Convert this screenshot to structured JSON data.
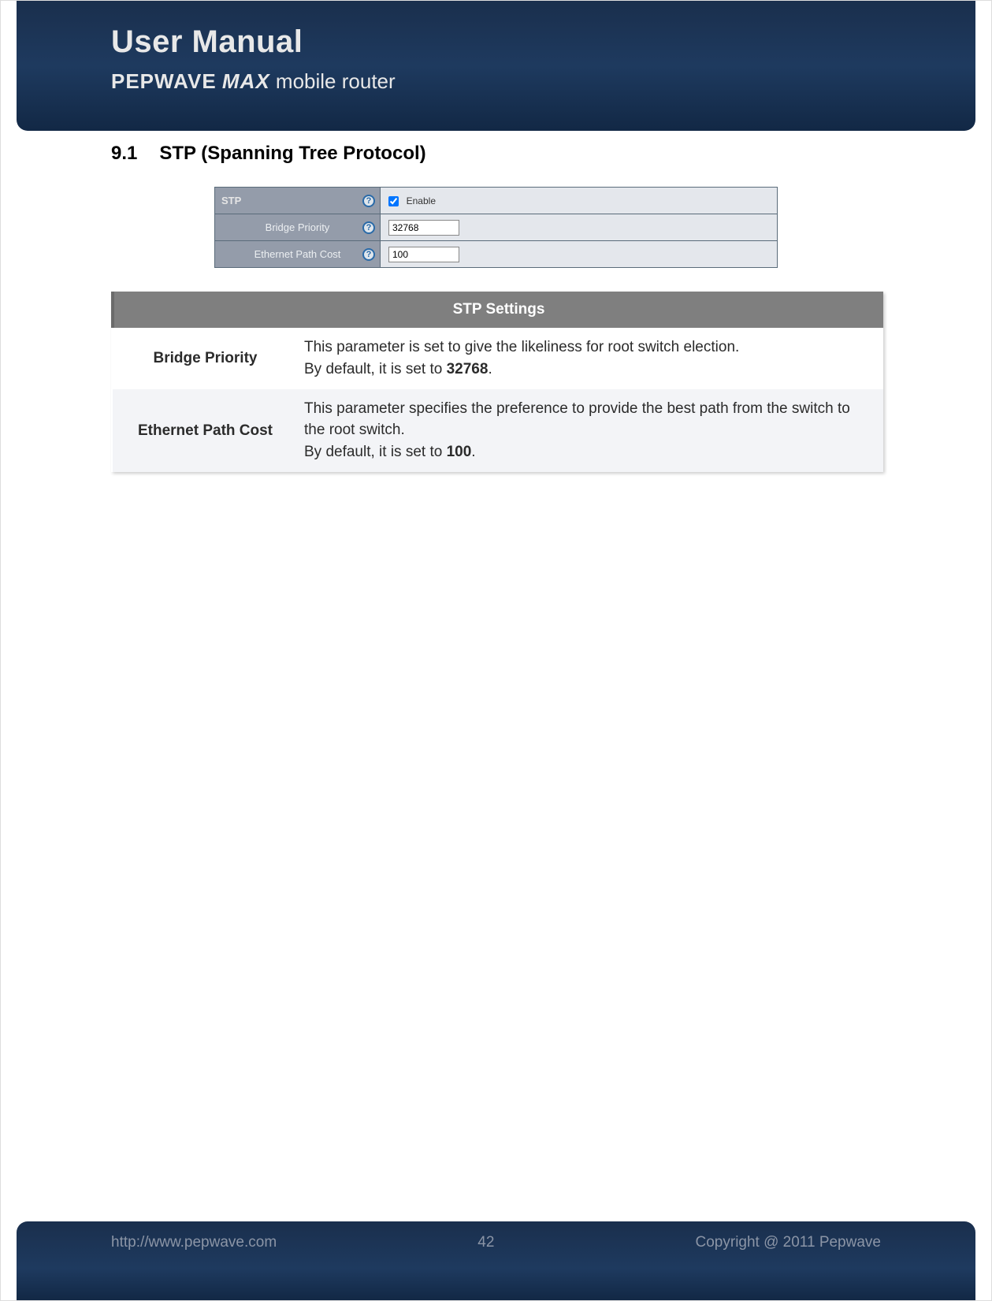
{
  "header": {
    "title": "User Manual",
    "brand": "PEPWAVE",
    "model": "MAX",
    "tail": "mobile router"
  },
  "section": {
    "number": "9.1",
    "title": "STP (Spanning Tree Protocol)"
  },
  "config": {
    "rows": [
      {
        "label": "STP",
        "type": "checkbox",
        "checked": true,
        "valueLabel": "Enable"
      },
      {
        "label": "Bridge Priority",
        "type": "text",
        "value": "32768"
      },
      {
        "label": "Ethernet Path Cost",
        "type": "text",
        "value": "100"
      }
    ],
    "help_glyph": "?"
  },
  "settings": {
    "header": "STP Settings",
    "rows": [
      {
        "name": "Bridge Priority",
        "desc": "This parameter is set to give the likeliness for root switch election.",
        "default_prefix": "By default, it is set to ",
        "default_value": "32768",
        "default_suffix": "."
      },
      {
        "name": "Ethernet Path Cost",
        "desc": "This parameter specifies the preference to provide the best path from the switch to the root switch.",
        "default_prefix": "By default, it is set to ",
        "default_value": "100",
        "default_suffix": "."
      }
    ]
  },
  "footer": {
    "url": "http://www.pepwave.com",
    "page": "42",
    "copyright": "Copyright @ 2011 Pepwave"
  }
}
